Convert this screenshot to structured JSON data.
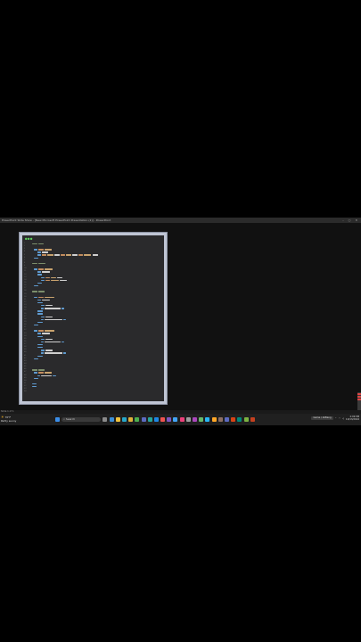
{
  "window": {
    "title": "PowerPoint Slide Show - [New Microsoft PowerPoint Presentation (2)] - PowerPoint",
    "controls": [
      "–",
      "▢",
      "✕"
    ]
  },
  "status_bar": {
    "text": "Slide 1 of 1"
  },
  "taskbar": {
    "weather": {
      "temp": "70°F",
      "condition": "Partly sunny"
    },
    "search_placeholder": "Search",
    "tray_app_label": "Game / AllBang",
    "clock": {
      "time": "2:09 PM",
      "date": "10/13/2024"
    }
  },
  "colors": {
    "comment": "#7c8e6b",
    "tag": "#5f9bd1",
    "attr": "#c38d5e",
    "text": "#cfcfcf",
    "string": "#c9a36e"
  },
  "editor": {
    "line_count": 54
  }
}
